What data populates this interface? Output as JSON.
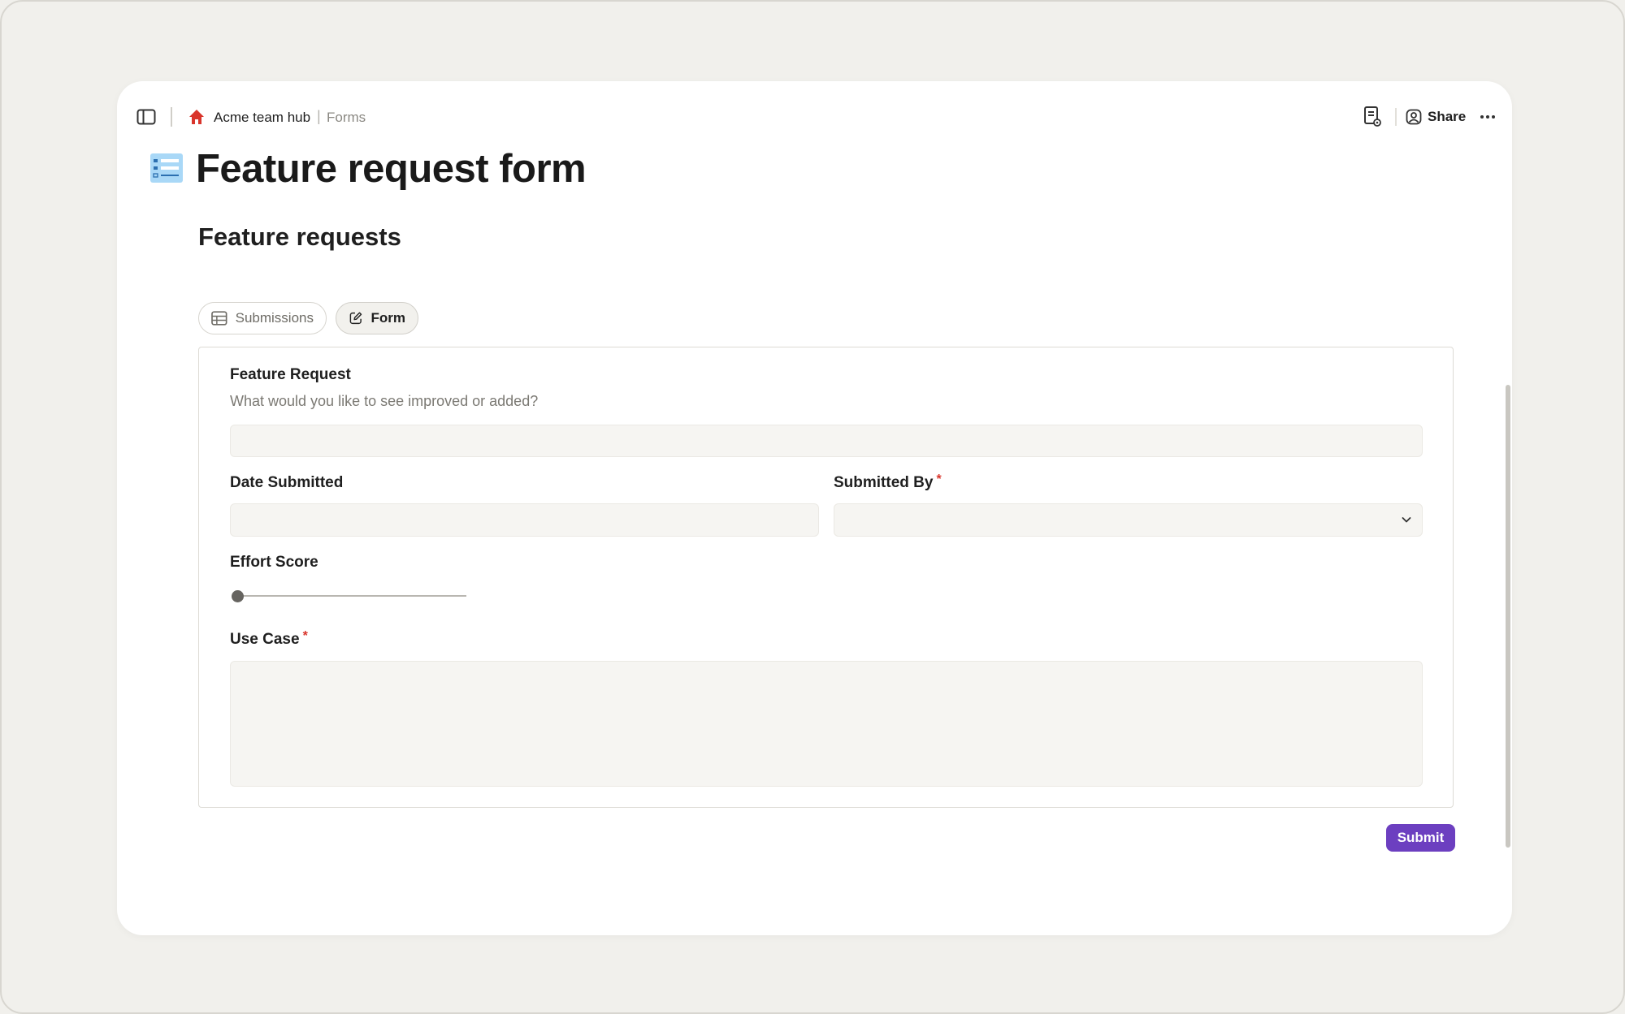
{
  "breadcrumb": {
    "workspace": "Acme team hub",
    "separator": "|",
    "page": "Forms"
  },
  "header": {
    "share_label": "Share"
  },
  "page": {
    "title": "Feature request form",
    "icon": "form-list-icon"
  },
  "database": {
    "title": "Feature requests",
    "tabs": [
      {
        "label": "Submissions",
        "icon": "table-icon",
        "active": false
      },
      {
        "label": "Form",
        "icon": "form-edit-icon",
        "active": true
      }
    ]
  },
  "form": {
    "fields": {
      "feature_request": {
        "label": "Feature Request",
        "hint": "What would you like to see improved or added?",
        "value": ""
      },
      "date_submitted": {
        "label": "Date Submitted",
        "value": ""
      },
      "submitted_by": {
        "label": "Submitted By",
        "required_mark": "*",
        "value": ""
      },
      "effort_score": {
        "label": "Effort Score",
        "value": 0
      },
      "use_case": {
        "label": "Use Case",
        "required_mark": "*",
        "value": ""
      }
    },
    "submit_label": "Submit"
  },
  "colors": {
    "accent": "#6c3fc0",
    "required": "#d9342b",
    "background": "#f1f0ec",
    "field_bg": "#f6f5f2"
  }
}
